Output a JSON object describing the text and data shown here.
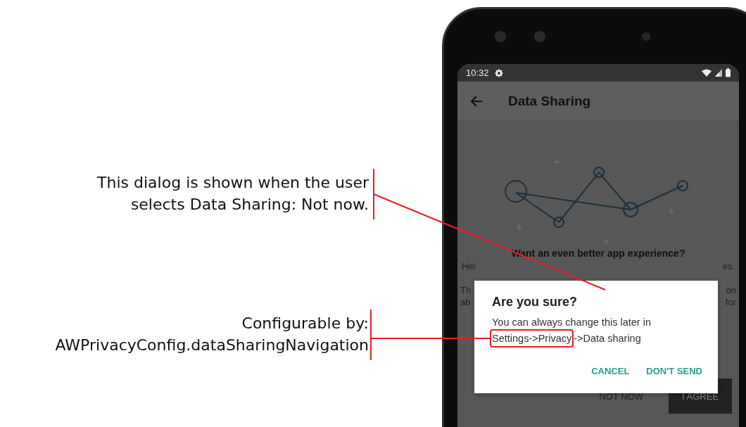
{
  "annotations": [
    {
      "lines": [
        "This dialog is shown when the user",
        "selects Data Sharing: Not now."
      ]
    },
    {
      "lines": [
        "Configurable by:",
        "AWPrivacyConfig.dataSharingNavigation"
      ]
    }
  ],
  "status_bar": {
    "time": "10:32"
  },
  "toolbar": {
    "title": "Data Sharing"
  },
  "content": {
    "heading": "Want an even better app experience?",
    "fragment_rows": [
      {
        "left": "Hel",
        "right": "es."
      },
      {
        "left": "Th",
        "right": "on"
      },
      {
        "left": "ab",
        "right": "for"
      }
    ],
    "buttons": [
      {
        "label": "NOT NOW",
        "kind": "text"
      },
      {
        "label": "I AGREE",
        "kind": "filled"
      }
    ]
  },
  "dialog": {
    "title": "Are you sure?",
    "message": "You can always change this later in",
    "highlighted_path": "Settings->Privacy",
    "path_rest": "->Data sharing",
    "buttons": [
      "CANCEL",
      "DON'T SEND"
    ]
  }
}
